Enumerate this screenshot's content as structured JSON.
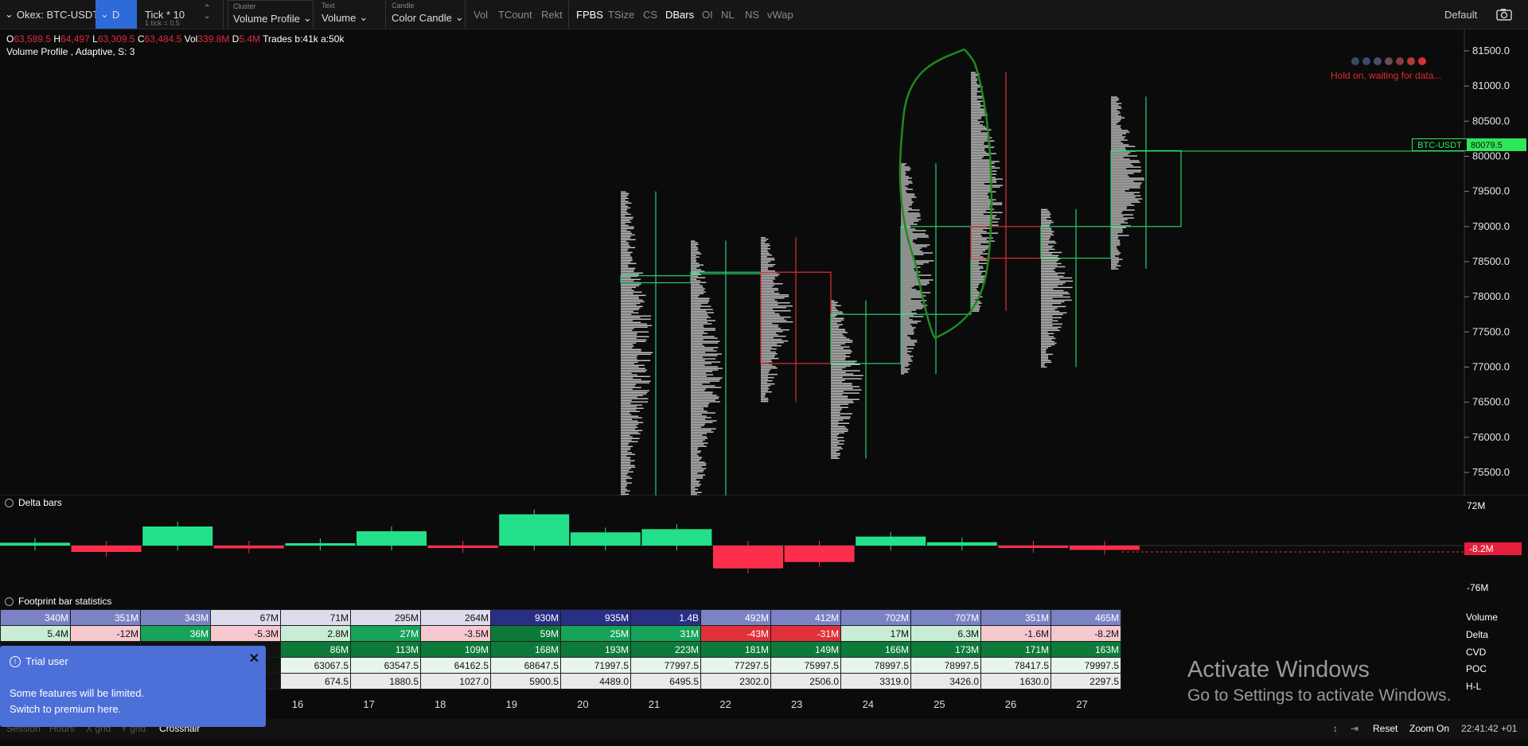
{
  "toolbar": {
    "symbol": "Okex: BTC-USDT",
    "period": "D",
    "tick_label": "Tick * 10",
    "tick_sub": "1 tick = 0.5",
    "cluster_caption": "Cluster",
    "cluster_value": "Volume Profile",
    "text_caption": "Text",
    "text_value": "Volume",
    "candle_caption": "Candle",
    "candle_value": "Color Candle",
    "toggles": [
      "Vol",
      "TCount",
      "Rekt",
      "FPBS",
      "TSize",
      "CS",
      "DBars",
      "OI",
      "NL",
      "NS",
      "vWap"
    ],
    "toggles_active": [
      "FPBS",
      "DBars"
    ],
    "template": "Default",
    "camera_icon": "camera-icon"
  },
  "ohlc": {
    "o_label": "O",
    "o_value": "63,589.5",
    "h_label": "H",
    "h_value": "64,497",
    "l_label": "L",
    "l_value": "63,309.5",
    "c_label": "C",
    "c_value": "63,484.5",
    "vol_label": "Vol",
    "vol_value": "339.8M",
    "d_label": "D",
    "d_value": "5.4M",
    "trades": "Trades b:41k a:50k"
  },
  "indicator_info": "Volume Profile , Adaptive, S: 3",
  "waiting_text": "Hold on, waiting for data...",
  "price_axis": [
    "81500.0",
    "81000.0",
    "80500.0",
    "80000.0",
    "79500.0",
    "79000.0",
    "78500.0",
    "78000.0",
    "77500.0",
    "77000.0",
    "76500.0",
    "76000.0",
    "75500.0"
  ],
  "price_tag": {
    "symbol": "BTC-USDT",
    "price": "80079.5"
  },
  "candles": [
    {
      "day": "20",
      "open": 78200,
      "high": 79500,
      "low": 75000,
      "close": 78300
    },
    {
      "day": "21",
      "open": 78350,
      "high": 78800,
      "low": 75000,
      "close": 78350
    },
    {
      "day": "22",
      "open": 78350,
      "high": 78850,
      "low": 76500,
      "close": 77050
    },
    {
      "day": "23",
      "open": 77050,
      "high": 77950,
      "low": 75700,
      "close": 77750
    },
    {
      "day": "24",
      "open": 77750,
      "high": 79900,
      "low": 76900,
      "close": 79000
    },
    {
      "day": "25",
      "open": 79000,
      "high": 81200,
      "low": 77800,
      "close": 78550
    },
    {
      "day": "26",
      "open": 78550,
      "high": 79250,
      "low": 77000,
      "close": 79000
    },
    {
      "day": "27",
      "open": 79000,
      "high": 80850,
      "low": 78400,
      "close": 80079.5
    }
  ],
  "delta_pane": {
    "title": "Delta bars",
    "axis_top": "72M",
    "axis_bottom": "-76M",
    "current": "-8.2M"
  },
  "stats": {
    "title": "Footprint bar statistics",
    "row_labels": [
      "Volume",
      "Delta",
      "CVD",
      "POC",
      "H-L"
    ],
    "volume": [
      "340M",
      "351M",
      "343M",
      "67M",
      "71M",
      "295M",
      "264M",
      "930M",
      "935M",
      "1.4B",
      "492M",
      "412M",
      "702M",
      "707M",
      "351M",
      "465M"
    ],
    "delta": [
      "5.4M",
      "-12M",
      "36M",
      "-5.3M",
      "2.8M",
      "27M",
      "-3.5M",
      "59M",
      "25M",
      "31M",
      "-43M",
      "-31M",
      "17M",
      "6.3M",
      "-1.6M",
      "-8.2M"
    ],
    "cvd": [
      "",
      "",
      "",
      "",
      "86M",
      "113M",
      "109M",
      "168M",
      "193M",
      "223M",
      "181M",
      "149M",
      "166M",
      "173M",
      "171M",
      "163M"
    ],
    "poc": [
      "",
      "",
      "",
      "",
      "63067.5",
      "63547.5",
      "64162.5",
      "68647.5",
      "71997.5",
      "77997.5",
      "77297.5",
      "75997.5",
      "78997.5",
      "78997.5",
      "78417.5",
      "79997.5"
    ],
    "hl": [
      "",
      "",
      "",
      "",
      "674.5",
      "1880.5",
      "1027.0",
      "5900.5",
      "4489.0",
      "6495.5",
      "2302.0",
      "2506.0",
      "3319.0",
      "3426.0",
      "1630.0",
      "2297.5"
    ]
  },
  "dates": [
    "16",
    "17",
    "18",
    "19",
    "20",
    "21",
    "22",
    "23",
    "24",
    "25",
    "26",
    "27"
  ],
  "trial": {
    "title": "Trial user",
    "line1": "Some features will be limited.",
    "line2": "Switch to premium here."
  },
  "bottom": {
    "left_items": [
      "Session",
      "Hours",
      "X grid",
      "Y grid",
      "Crosshair"
    ],
    "reset": "Reset",
    "zoom": "Zoom On",
    "clock": "22:41:42 +01"
  },
  "watermark": {
    "line1": "Activate Windows",
    "line2": "Go to Settings to activate Windows."
  }
}
